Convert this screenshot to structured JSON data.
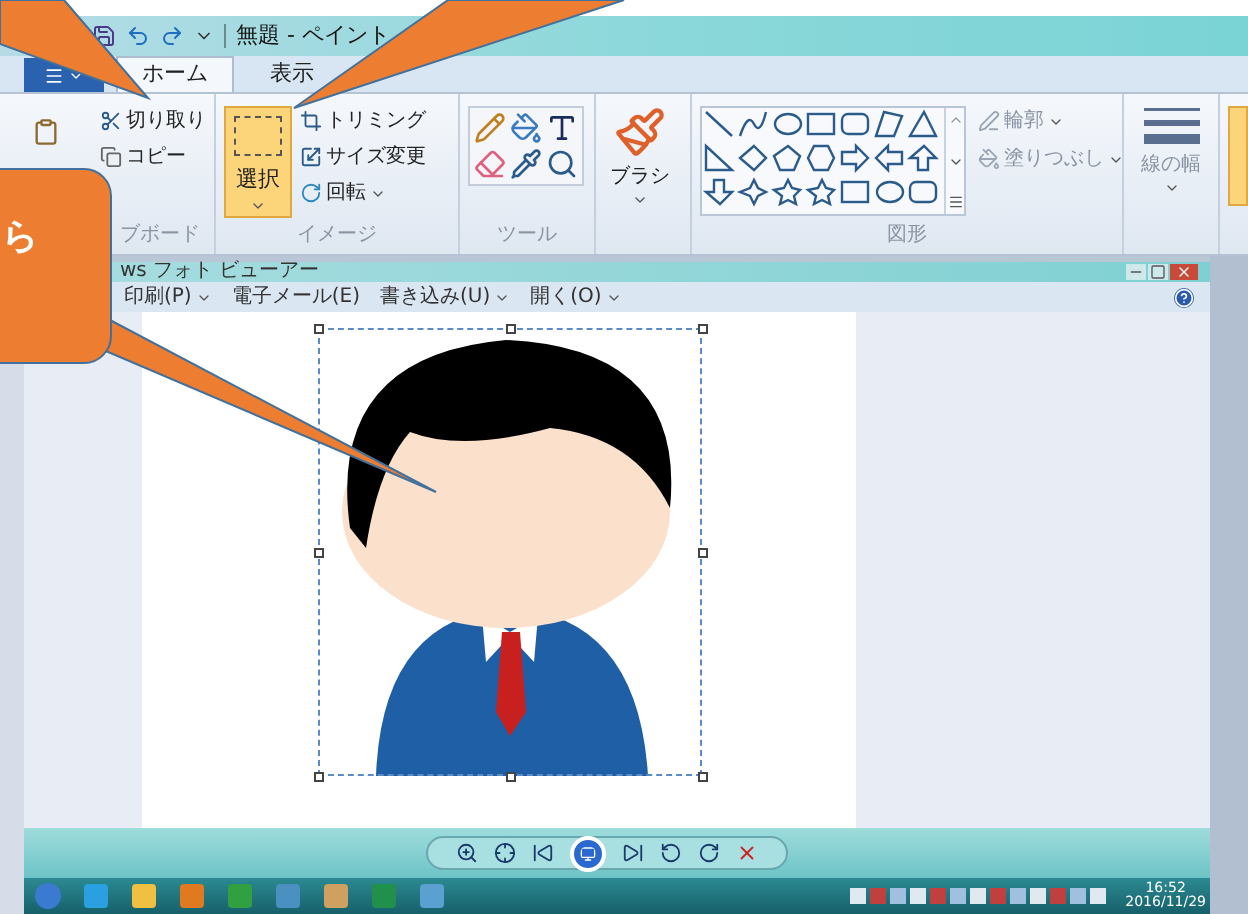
{
  "window": {
    "title": "無題 - ペイント"
  },
  "tabs": [
    {
      "label": "ホーム",
      "selected": true
    },
    {
      "label": "表示",
      "selected": false
    }
  ],
  "ribbon": {
    "clipboard": {
      "label": "ブボード",
      "items": [
        "切り取り",
        "コピー"
      ]
    },
    "image": {
      "label": "イメージ",
      "select": {
        "label": "選択",
        "selected": true
      },
      "items": [
        "トリミング",
        "サイズ変更",
        "回転"
      ]
    },
    "tools": {
      "label": "ツール"
    },
    "brush": {
      "label": "ブラシ"
    },
    "shapes": {
      "label": "図形",
      "outline": "輪郭",
      "fill": "塗りつぶし"
    },
    "line_width": {
      "label": "線の幅"
    }
  },
  "photo_viewer": {
    "title": "ws フォト ビューアー",
    "menu": [
      {
        "label": "印刷(P)",
        "dropdown": true
      },
      {
        "label": "電子メール(E)",
        "dropdown": false
      },
      {
        "label": "書き込み(U)",
        "dropdown": true
      },
      {
        "label": "開く(O)",
        "dropdown": true
      }
    ]
  },
  "taskbar": {
    "time": "16:52",
    "date": "2016/11/29"
  },
  "callout": {
    "text": "ら"
  }
}
